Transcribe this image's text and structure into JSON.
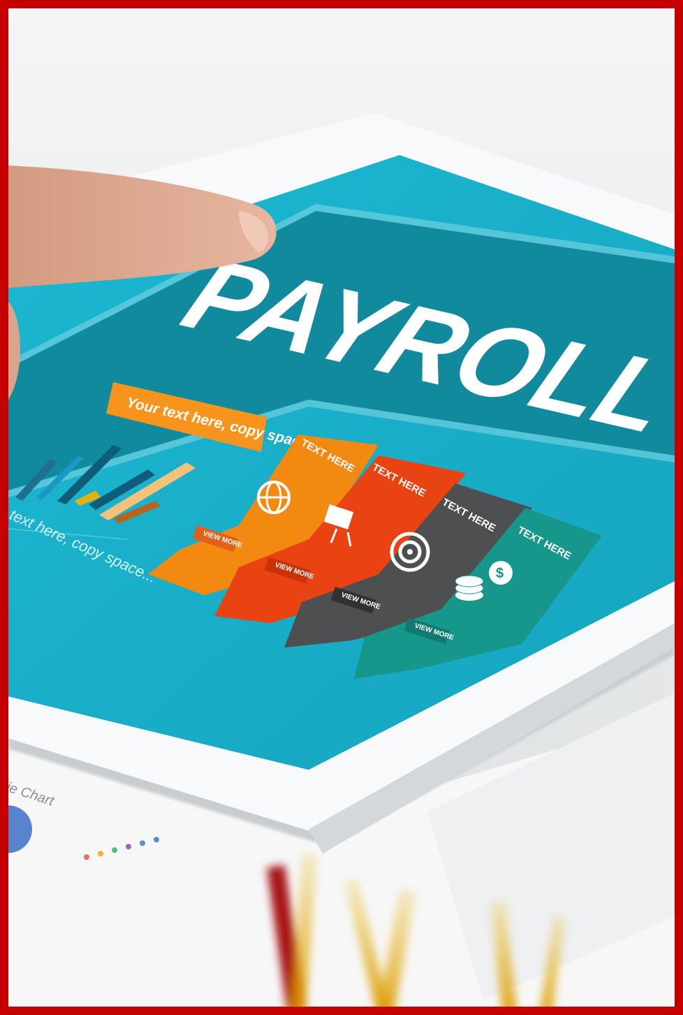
{
  "scene": {
    "description_colors": {
      "frame": "#c40000",
      "screen": "#19aecb",
      "banner": "#118a9e",
      "tab_orange": "#f28a12",
      "tab_red": "#ea4313",
      "tab_dark": "#4d4f50",
      "tab_green": "#17978b",
      "label_bg": "#f7941d"
    }
  },
  "screen": {
    "title": "PAYROLL",
    "callout": "Your text here, copy space...",
    "caption": "text here, copy space...",
    "tabs": [
      {
        "heading": "TEXT HERE",
        "button": "VIEW MORE",
        "icon": "globe-icon"
      },
      {
        "heading": "TEXT HERE",
        "button": "VIEW MORE",
        "icon": "presentation-board-icon"
      },
      {
        "heading": "TEXT HERE",
        "button": "VIEW MORE",
        "icon": "target-icon"
      },
      {
        "heading": "TEXT HERE",
        "button": "VIEW MORE",
        "icon": "coins-icon"
      }
    ]
  },
  "paper": {
    "label": "ie Chart"
  }
}
